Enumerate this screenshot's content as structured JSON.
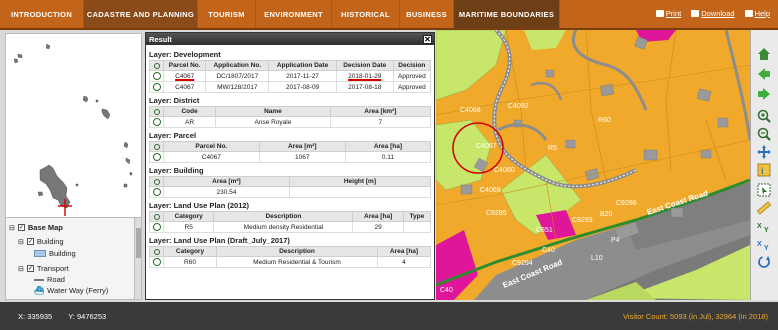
{
  "nav": {
    "tabs": [
      "INTRODUCTION",
      "CADASTRE AND PLANNING",
      "TOURISM",
      "ENVIRONMENT",
      "HISTORICAL",
      "BUSINESS",
      "MARITIME BOUNDARIES"
    ],
    "print_label": "Print",
    "download_label": "Download",
    "help_label": "Help"
  },
  "layers_panel": {
    "base_map": "Base Map",
    "building_group": "Building",
    "building_item": "Building",
    "transport_group": "Transport",
    "road": "Road",
    "water_way": "Water Way (Ferry)"
  },
  "result": {
    "title": "Result",
    "development": {
      "title": "Layer: Development",
      "headers": [
        "Parcel No.",
        "Application No.",
        "Application Date",
        "Decision Date",
        "Decision"
      ],
      "rows": [
        [
          "C4067",
          "DC/1807/2017",
          "2017-11-27",
          "2018-01-29",
          "Approved"
        ],
        [
          "C4067",
          "MW/128/2017",
          "2017-08-09",
          "2017-08-18",
          "Approved"
        ]
      ]
    },
    "district": {
      "title": "Layer: District",
      "headers": [
        "Code",
        "Name",
        "Area [km²]"
      ],
      "row": [
        "AR",
        "Anse Royale",
        "7"
      ]
    },
    "parcel": {
      "title": "Layer: Parcel",
      "headers": [
        "Parcel No.",
        "Area [m²]",
        "Area [ha]"
      ],
      "row": [
        "C4067",
        "1067",
        "0.11"
      ]
    },
    "building": {
      "title": "Layer: Building",
      "headers": [
        "Area [m²]",
        "Height [m]"
      ],
      "row": [
        "230.54",
        ""
      ]
    },
    "landuse2012": {
      "title": "Layer: Land Use Plan (2012)",
      "headers": [
        "Category",
        "Description",
        "Area [ha]",
        "Type"
      ],
      "row": [
        "R5",
        "Medium density Residential",
        "29",
        ""
      ]
    },
    "landuse2017": {
      "title": "Layer: Land Use Plan (Draft_July_2017)",
      "headers": [
        "Category",
        "Description",
        "Area [ha]"
      ],
      "row": [
        "R60",
        "Medium Residential & Tourism",
        "4"
      ]
    }
  },
  "map": {
    "labels": [
      "C4068",
      "C4092",
      "C4067",
      "C4060",
      "C4069",
      "R60",
      "R5",
      "C851",
      "C9286",
      "C9293",
      "B20",
      "C9285",
      "C40",
      "C9294",
      "P4",
      "L10",
      "C40"
    ],
    "road_label_1": "East Coast Road",
    "road_label_2": "East Coast Road",
    "colors": {
      "residential": "#f0a92b",
      "green": "#c8e66a",
      "magenta": "#e0169a",
      "road": "#8d8d8d",
      "selection": "#d00000"
    }
  },
  "status": {
    "x_label": "X:",
    "x_value": "335935",
    "y_label": "Y:",
    "y_value": "9476253",
    "visitor": "Visitor Count: 5093 (in Jul), 32964 (in 2018)"
  }
}
